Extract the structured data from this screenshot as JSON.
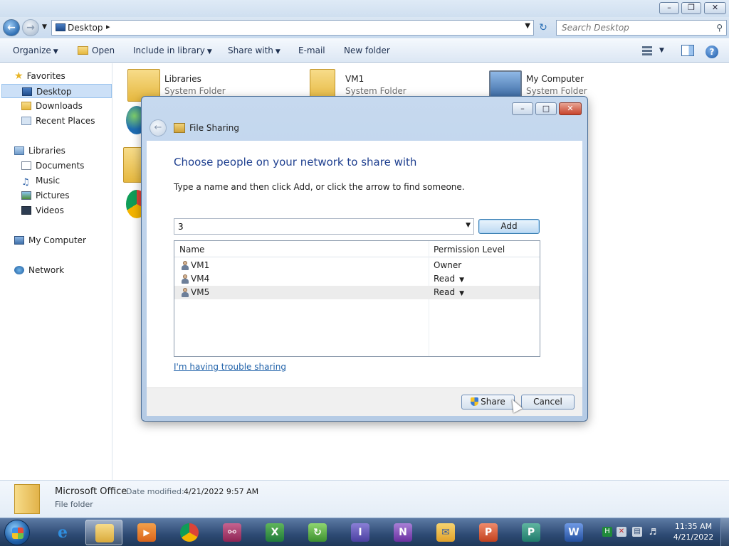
{
  "address": {
    "path": "Desktop"
  },
  "search": {
    "placeholder": "Search Desktop"
  },
  "toolbar": {
    "organize": "Organize",
    "open": "Open",
    "include_in_library": "Include in library",
    "share_with": "Share with",
    "email": "E-mail",
    "new_folder": "New folder"
  },
  "nav": {
    "favorites": "Favorites",
    "desktop": "Desktop",
    "downloads": "Downloads",
    "recent_places": "Recent Places",
    "libraries": "Libraries",
    "documents": "Documents",
    "music": "Music",
    "pictures": "Pictures",
    "videos": "Videos",
    "my_computer": "My Computer",
    "network": "Network"
  },
  "content": {
    "items": [
      {
        "name": "Libraries",
        "type": "System Folder"
      },
      {
        "name": "VM1",
        "type": "System Folder"
      },
      {
        "name": "My Computer",
        "type": "System Folder"
      }
    ]
  },
  "details": {
    "name": "Microsoft Office",
    "date_modified_label": "Date modified:",
    "date_modified_value": "4/21/2022 9:57 AM",
    "type": "File folder"
  },
  "dialog": {
    "title": "File Sharing",
    "heading": "Choose people on your network to share with",
    "instruction": "Type a name and then click Add, or click the arrow to find someone.",
    "input_value": "3",
    "add_label": "Add",
    "columns": {
      "name": "Name",
      "permission": "Permission Level"
    },
    "rows": [
      {
        "name": "VM1",
        "permission": "Owner"
      },
      {
        "name": "VM4",
        "permission": "Read"
      },
      {
        "name": "VM5",
        "permission": "Read"
      }
    ],
    "trouble_link": "I'm having trouble sharing",
    "share_label": "Share",
    "cancel_label": "Cancel"
  },
  "taskbar": {
    "time": "11:35 AM",
    "date": "4/21/2022"
  },
  "colors": {
    "accent": "#1e3f8f",
    "link": "#1c5fa8",
    "taskbar": "#2d4a73",
    "selection": "#cce0f7"
  }
}
